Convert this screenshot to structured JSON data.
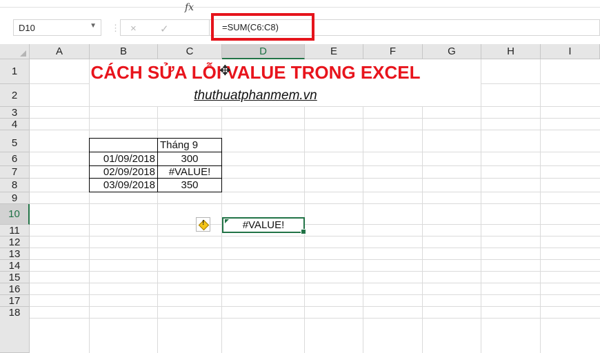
{
  "name_box": {
    "value": "D10"
  },
  "formula_bar": {
    "cancel_icon": "×",
    "enter_icon": "✓",
    "fx_label": "fx",
    "formula": "=SUM(C6:C8)"
  },
  "columns": [
    "A",
    "B",
    "C",
    "D",
    "E",
    "F",
    "G",
    "H",
    "I"
  ],
  "rows": [
    "1",
    "2",
    "3",
    "4",
    "5",
    "6",
    "7",
    "8",
    "9",
    "10",
    "11",
    "12",
    "13",
    "14",
    "15",
    "16",
    "17",
    "18"
  ],
  "active_cell": {
    "column": "D",
    "row": "10"
  },
  "sheet": {
    "title": "CÁCH SỬA LỖI VALUE TRONG EXCEL",
    "subtitle": "thuthuatphanmem.vn",
    "table": {
      "header": "Tháng 9",
      "rows": [
        {
          "date": "01/09/2018",
          "value": "300"
        },
        {
          "date": "02/09/2018",
          "value": "#VALUE!"
        },
        {
          "date": "03/09/2018",
          "value": "350"
        }
      ]
    },
    "result_cell": "#VALUE!"
  },
  "icons": {
    "dropdown": "chevron-down-icon",
    "error_indicator": "warning-icon",
    "cursor": "cell-cursor-icon"
  },
  "colors": {
    "accent": "#217346",
    "highlight_box": "#e5141c",
    "title": "#e8141c"
  }
}
